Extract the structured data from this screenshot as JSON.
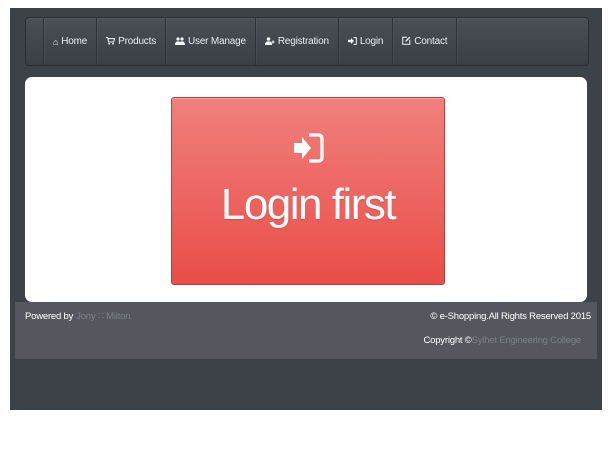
{
  "nav": {
    "items": [
      {
        "icon": "home-icon",
        "label": "Home"
      },
      {
        "icon": "cart-icon",
        "label": "Products"
      },
      {
        "icon": "users-icon",
        "label": "User Manage"
      },
      {
        "icon": "user-plus-icon",
        "label": "Registration"
      },
      {
        "icon": "sign-in-icon",
        "label": "Login"
      },
      {
        "icon": "edit-icon",
        "label": "Contact"
      }
    ]
  },
  "main": {
    "login_card": {
      "icon": "sign-in-icon",
      "text": "Login first"
    }
  },
  "footer": {
    "powered_by": "Powered by",
    "author": "Jony ∷ Milton",
    "rights": "© e-Shopping.All Rights Reserved 2015",
    "copyright_prefix": "Copyright ©",
    "college": "Sylhet Engineering College"
  },
  "colors": {
    "background_dark": "#3d4248",
    "footer_band": "#54585e",
    "login_card": "#ea4d48",
    "muted_link": "#7c8087"
  }
}
